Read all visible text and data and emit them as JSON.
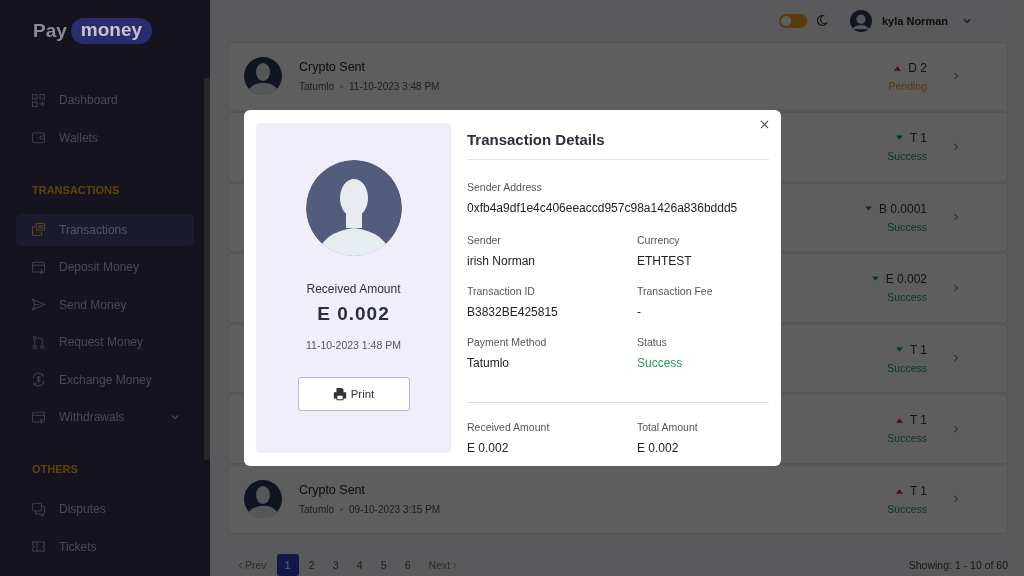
{
  "brand": {
    "part_1": "Pay",
    "part_2": "money"
  },
  "sidebar": {
    "sections": [
      {
        "items": [
          {
            "label": "Dashboard",
            "selected": false,
            "submenu": false
          },
          {
            "label": "Wallets",
            "selected": false,
            "submenu": false
          }
        ]
      },
      {
        "heading": "TRANSACTIONS",
        "items": [
          {
            "label": "Transactions",
            "selected": true,
            "submenu": false
          },
          {
            "label": "Deposit Money",
            "selected": false,
            "submenu": false
          },
          {
            "label": "Send Money",
            "selected": false,
            "submenu": false
          },
          {
            "label": "Request Money",
            "selected": false,
            "submenu": false
          },
          {
            "label": "Exchange Money",
            "selected": false,
            "submenu": false
          },
          {
            "label": "Withdrawals",
            "selected": false,
            "submenu": true
          }
        ]
      },
      {
        "heading": "OTHERS",
        "items": [
          {
            "label": "Disputes",
            "selected": false,
            "submenu": false
          },
          {
            "label": "Tickets",
            "selected": false,
            "submenu": false
          }
        ]
      }
    ]
  },
  "header": {
    "dark_mode": false,
    "user_name": "kyla Norman"
  },
  "transactions": [
    {
      "title": "Crypto Sent",
      "method": "Tatumlo",
      "date": "11-10-2023 3:48 PM",
      "kind": "up",
      "amount": "D 2",
      "status": "Pending",
      "pending": true
    },
    {
      "kind": "down",
      "amount": "T 1",
      "status": "Success",
      "pending": false
    },
    {
      "kind": "down",
      "amount": "B 0.0001",
      "status": "Success",
      "pending": false
    },
    {
      "kind": "down",
      "amount": "E 0.002",
      "status": "Success",
      "pending": false
    },
    {
      "kind": "down",
      "amount": "T 1",
      "status": "Success",
      "pending": false
    },
    {
      "kind": "up",
      "amount": "T 1",
      "status": "Success",
      "pending": false
    },
    {
      "title": "Crypto Sent",
      "method": "Tatumlo",
      "date": "09-10-2023 3:15 PM",
      "kind": "up",
      "amount": "T 1",
      "status": "Success",
      "pending": false
    }
  ],
  "pagination": {
    "prev": "Prev",
    "pages": [
      {
        "label": "1",
        "selected": true
      },
      {
        "label": "2",
        "selected": false
      },
      {
        "label": "3",
        "selected": false
      },
      {
        "label": "4",
        "selected": false
      },
      {
        "label": "5",
        "selected": false
      },
      {
        "label": "6",
        "selected": false
      }
    ],
    "next": "Next",
    "showing": "Showing: 1 - 10 of 60"
  },
  "modal": {
    "summary": {
      "label": "Received Amount",
      "amount": "E 0.002",
      "date": "11-10-2023 1:48 PM",
      "print": "Print"
    },
    "title": "Transaction Details",
    "address": {
      "label": "Sender Address",
      "value": "0xfb4a9df1e4c406eeaccd957c98a1426a836bddd5"
    },
    "fields": [
      {
        "label": "Sender",
        "value": "irish Norman",
        "kind": "text"
      },
      {
        "label": "Currency",
        "value": "ETHTEST",
        "kind": "text"
      },
      {
        "label": "Transaction ID",
        "value": "B3832BE425815",
        "kind": "text"
      },
      {
        "label": "Transaction Fee",
        "value": "-",
        "kind": "text"
      },
      {
        "label": "Payment Method",
        "value": "Tatumlo",
        "kind": "text"
      },
      {
        "label": "Status",
        "value": "Success",
        "kind": "status"
      }
    ],
    "totals": [
      {
        "label": "Received Amount",
        "value": "E 0.002"
      },
      {
        "label": "Total Amount",
        "value": "E 0.002"
      }
    ]
  }
}
